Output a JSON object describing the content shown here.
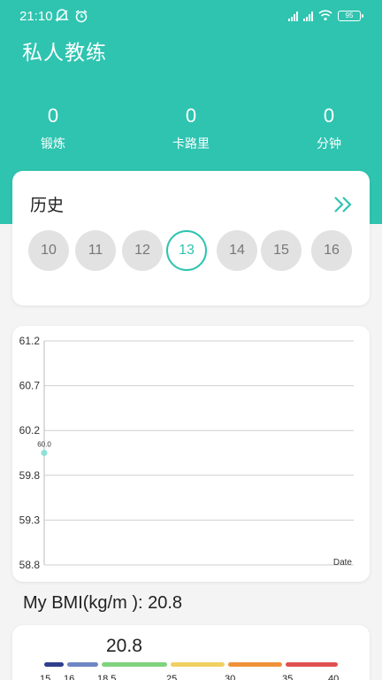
{
  "status_bar": {
    "time": "21:10",
    "battery": "95"
  },
  "app": {
    "title": "私人教练"
  },
  "stats": [
    {
      "value": "0",
      "label": "锻炼"
    },
    {
      "value": "0",
      "label": "卡路里"
    },
    {
      "value": "0",
      "label": "分钟"
    }
  ],
  "history": {
    "title": "历史",
    "days": [
      "10",
      "11",
      "12",
      "13",
      "14",
      "15",
      "16"
    ],
    "selected_day": "13"
  },
  "chart_data": {
    "type": "scatter",
    "x_label": "Date",
    "y_ticks": [
      "61.2",
      "60.7",
      "60.2",
      "59.8",
      "59.3",
      "58.8"
    ],
    "ylim": [
      58.8,
      61.2
    ],
    "points": [
      {
        "y": 60.0,
        "label": "60.0"
      }
    ],
    "grid": true
  },
  "bmi": {
    "label": "My BMI(kg/m ): 20.8",
    "value": "20.8",
    "scale_ticks": [
      "15",
      "16",
      "18.5",
      "25",
      "30",
      "35",
      "40"
    ],
    "segment_colors": [
      "#2f3e8c",
      "#6f86c4",
      "#7fd37f",
      "#f0d060",
      "#f0913a",
      "#e05050"
    ]
  },
  "colors": {
    "accent": "#2ec4b0"
  }
}
